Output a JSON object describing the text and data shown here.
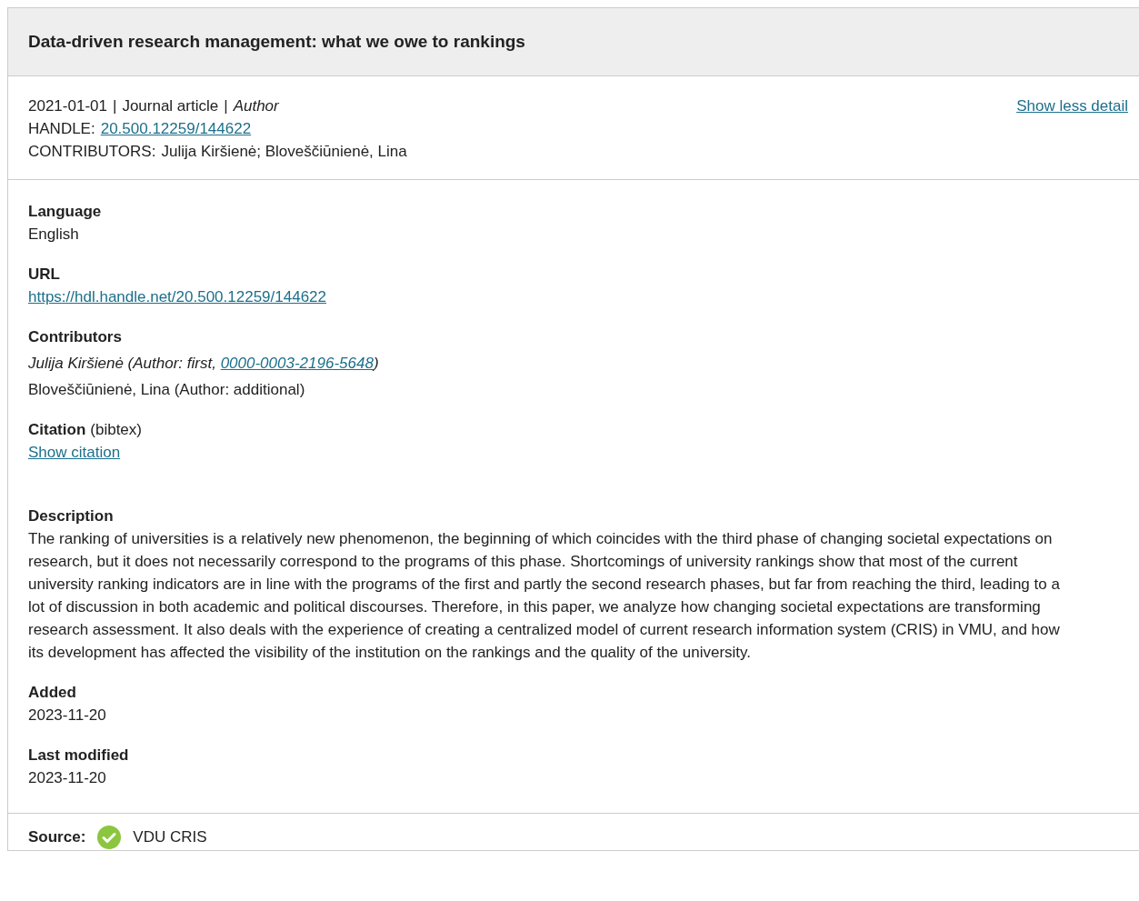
{
  "title": "Data-driven research management: what we owe to rankings",
  "summary": {
    "meta": [
      {
        "text": "2021-01-01",
        "italic": false
      },
      {
        "text": "Journal article",
        "italic": false
      },
      {
        "text": "Author",
        "italic": true
      }
    ],
    "separator": "|",
    "handle_label": "HANDLE:",
    "handle": "20.500.12259/144622",
    "contributors_label": "CONTRIBUTORS:",
    "contributors": "Julija Kiršienė; Bloveščiūnienė, Lina"
  },
  "toggle_link": "Show less detail",
  "fields": [
    {
      "kind": "text",
      "label": "Language",
      "value": "English"
    },
    {
      "kind": "link",
      "label": "URL",
      "value": "https://hdl.handle.net/20.500.12259/144622"
    },
    {
      "kind": "contributors",
      "label": "Contributors",
      "items": [
        {
          "text": "Julija Kiršienė (Author: first, ",
          "orcid": "0000-0003-2196-5648",
          "suffix": ")",
          "italic": true
        },
        {
          "text": "Bloveščiūnienė, Lina (Author: additional)",
          "italic": false
        }
      ]
    },
    {
      "kind": "citation",
      "label": "Citation",
      "format": "(bibtex)",
      "link": "Show citation"
    },
    {
      "kind": "text",
      "label": "Description",
      "value": "The ranking of universities is a relatively new phenomenon, the beginning of which coincides with the third phase of changing societal expectations on research, but it does not necessarily correspond to the programs of this phase. Shortcomings of university rankings show that most of the current university ranking indicators are in line with the programs of the first and partly the second research phases, but far from reaching the third, leading to a lot of discussion in both academic and political discourses. Therefore, in this paper, we analyze how changing societal expectations are transforming research assessment. It also deals with the experience of creating a centralized model of current research information system (CRIS) in VMU, and how its development has affected the visibility of the institution on the rankings and the quality of the university."
    },
    {
      "kind": "text",
      "label": "Added",
      "value": "2023-11-20"
    },
    {
      "kind": "text",
      "label": "Last modified",
      "value": "2023-11-20"
    }
  ],
  "source": {
    "label": "Source:",
    "name": "VDU CRIS"
  }
}
